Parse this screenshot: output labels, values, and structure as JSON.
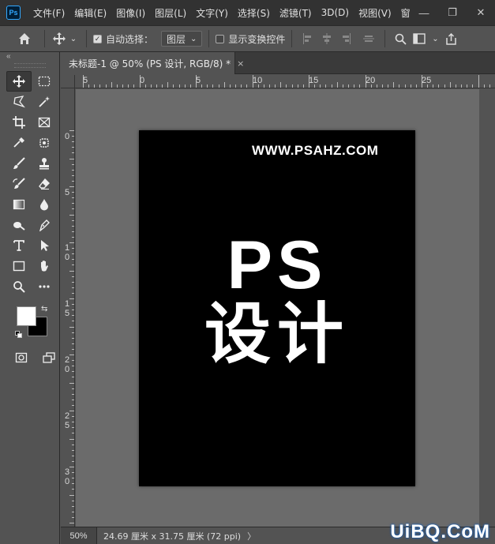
{
  "app": {
    "logo_text": "Ps",
    "accent": "#31a8ff"
  },
  "menu": [
    "文件(F)",
    "编辑(E)",
    "图像(I)",
    "图层(L)",
    "文字(Y)",
    "选择(S)",
    "滤镜(T)",
    "3D(D)",
    "视图(V)",
    "窗口(W"
  ],
  "window_controls": {
    "minimize": "—",
    "restore": "❐",
    "close": "✕"
  },
  "options_bar": {
    "auto_select_label": "自动选择：",
    "auto_select_checked": true,
    "target_value": "图层",
    "show_transform_label": "显示变换控件",
    "show_transform_checked": false
  },
  "document": {
    "tab_title": "未标题-1 @ 50% (PS 设计, RGB/8) *",
    "close": "×"
  },
  "rulers": {
    "h_labels": [
      "5",
      "0",
      "5",
      "10",
      "15",
      "20",
      "25"
    ],
    "v_labels": [
      "0",
      "5",
      "1\n0",
      "1\n5",
      "2\n0",
      "2\n5",
      "3\n0"
    ]
  },
  "canvas": {
    "background": "#000000",
    "watermark_text": "WWW.PSAHZ.COM",
    "headline": "PS",
    "subhead": "设计"
  },
  "colors": {
    "foreground": "#ffffff",
    "background": "#000000"
  },
  "status": {
    "zoom": "50%",
    "doc_size": "24.69 厘米 x 31.75 厘米 (72 ppi)",
    "arrow": "〉"
  },
  "corner_logo": "UiBQ.CoM"
}
